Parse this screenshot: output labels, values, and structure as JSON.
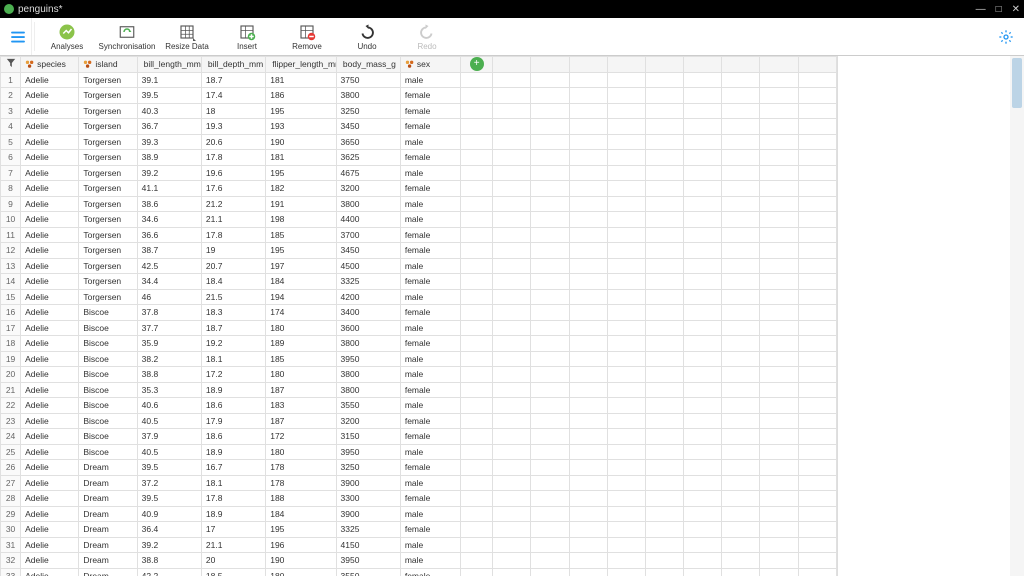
{
  "window": {
    "title": "penguins*"
  },
  "toolbar": {
    "analyses": "Analyses",
    "synchronisation": "Synchronisation",
    "resize_data": "Resize Data",
    "insert": "Insert",
    "remove": "Remove",
    "undo": "Undo",
    "redo": "Redo"
  },
  "columns": [
    {
      "name": "species",
      "type": "nominal"
    },
    {
      "name": "island",
      "type": "nominal"
    },
    {
      "name": "bill_length_mm",
      "type": "continuous"
    },
    {
      "name": "bill_depth_mm",
      "type": "continuous"
    },
    {
      "name": "flipper_length_mm",
      "type": "continuous"
    },
    {
      "name": "body_mass_g",
      "type": "continuous"
    },
    {
      "name": "sex",
      "type": "nominal"
    }
  ],
  "rows": [
    [
      "Adelie",
      "Torgersen",
      "39.1",
      "18.7",
      "181",
      "3750",
      "male"
    ],
    [
      "Adelie",
      "Torgersen",
      "39.5",
      "17.4",
      "186",
      "3800",
      "female"
    ],
    [
      "Adelie",
      "Torgersen",
      "40.3",
      "18",
      "195",
      "3250",
      "female"
    ],
    [
      "Adelie",
      "Torgersen",
      "36.7",
      "19.3",
      "193",
      "3450",
      "female"
    ],
    [
      "Adelie",
      "Torgersen",
      "39.3",
      "20.6",
      "190",
      "3650",
      "male"
    ],
    [
      "Adelie",
      "Torgersen",
      "38.9",
      "17.8",
      "181",
      "3625",
      "female"
    ],
    [
      "Adelie",
      "Torgersen",
      "39.2",
      "19.6",
      "195",
      "4675",
      "male"
    ],
    [
      "Adelie",
      "Torgersen",
      "41.1",
      "17.6",
      "182",
      "3200",
      "female"
    ],
    [
      "Adelie",
      "Torgersen",
      "38.6",
      "21.2",
      "191",
      "3800",
      "male"
    ],
    [
      "Adelie",
      "Torgersen",
      "34.6",
      "21.1",
      "198",
      "4400",
      "male"
    ],
    [
      "Adelie",
      "Torgersen",
      "36.6",
      "17.8",
      "185",
      "3700",
      "female"
    ],
    [
      "Adelie",
      "Torgersen",
      "38.7",
      "19",
      "195",
      "3450",
      "female"
    ],
    [
      "Adelie",
      "Torgersen",
      "42.5",
      "20.7",
      "197",
      "4500",
      "male"
    ],
    [
      "Adelie",
      "Torgersen",
      "34.4",
      "18.4",
      "184",
      "3325",
      "female"
    ],
    [
      "Adelie",
      "Torgersen",
      "46",
      "21.5",
      "194",
      "4200",
      "male"
    ],
    [
      "Adelie",
      "Biscoe",
      "37.8",
      "18.3",
      "174",
      "3400",
      "female"
    ],
    [
      "Adelie",
      "Biscoe",
      "37.7",
      "18.7",
      "180",
      "3600",
      "male"
    ],
    [
      "Adelie",
      "Biscoe",
      "35.9",
      "19.2",
      "189",
      "3800",
      "female"
    ],
    [
      "Adelie",
      "Biscoe",
      "38.2",
      "18.1",
      "185",
      "3950",
      "male"
    ],
    [
      "Adelie",
      "Biscoe",
      "38.8",
      "17.2",
      "180",
      "3800",
      "male"
    ],
    [
      "Adelie",
      "Biscoe",
      "35.3",
      "18.9",
      "187",
      "3800",
      "female"
    ],
    [
      "Adelie",
      "Biscoe",
      "40.6",
      "18.6",
      "183",
      "3550",
      "male"
    ],
    [
      "Adelie",
      "Biscoe",
      "40.5",
      "17.9",
      "187",
      "3200",
      "female"
    ],
    [
      "Adelie",
      "Biscoe",
      "37.9",
      "18.6",
      "172",
      "3150",
      "female"
    ],
    [
      "Adelie",
      "Biscoe",
      "40.5",
      "18.9",
      "180",
      "3950",
      "male"
    ],
    [
      "Adelie",
      "Dream",
      "39.5",
      "16.7",
      "178",
      "3250",
      "female"
    ],
    [
      "Adelie",
      "Dream",
      "37.2",
      "18.1",
      "178",
      "3900",
      "male"
    ],
    [
      "Adelie",
      "Dream",
      "39.5",
      "17.8",
      "188",
      "3300",
      "female"
    ],
    [
      "Adelie",
      "Dream",
      "40.9",
      "18.9",
      "184",
      "3900",
      "male"
    ],
    [
      "Adelie",
      "Dream",
      "36.4",
      "17",
      "195",
      "3325",
      "female"
    ],
    [
      "Adelie",
      "Dream",
      "39.2",
      "21.1",
      "196",
      "4150",
      "male"
    ],
    [
      "Adelie",
      "Dream",
      "38.8",
      "20",
      "190",
      "3950",
      "male"
    ],
    [
      "Adelie",
      "Dream",
      "42.2",
      "18.5",
      "180",
      "3550",
      "female"
    ]
  ],
  "icons": {
    "nominal_color": "#e89f3c",
    "continuous_color": "#e07b3c",
    "accent_green": "#4caf50",
    "gear_color": "#2196f3",
    "hamburger_color": "#2196f3"
  }
}
